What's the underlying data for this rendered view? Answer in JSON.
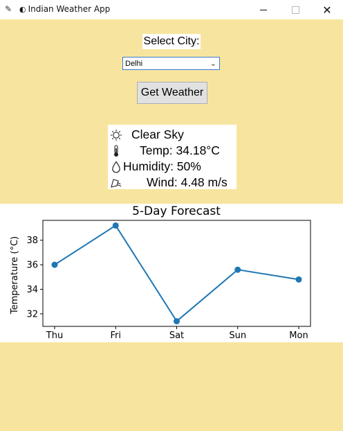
{
  "window": {
    "title": "Indian Weather App",
    "min_label": "—",
    "close_label": "✕"
  },
  "controls": {
    "select_label": "Select City:",
    "city_value": "Delhi",
    "button_label": "Get Weather"
  },
  "weather": {
    "condition": "Clear Sky",
    "temp": "Temp: 34.18°C",
    "humidity": "Humidity: 50%",
    "wind": "Wind: 4.48 m/s"
  },
  "colors": {
    "background": "#f7e59f",
    "line": "#1f77b4"
  },
  "chart_data": {
    "type": "line",
    "title": "5-Day Forecast",
    "xlabel": "",
    "ylabel": "Temperature (°C)",
    "categories": [
      "Thu",
      "Fri",
      "Sat",
      "Sun",
      "Mon"
    ],
    "values": [
      36.0,
      39.2,
      31.4,
      35.6,
      34.8
    ],
    "yticks": [
      32,
      34,
      36,
      38
    ],
    "ylim": [
      30.98,
      39.62
    ],
    "grid": false
  }
}
